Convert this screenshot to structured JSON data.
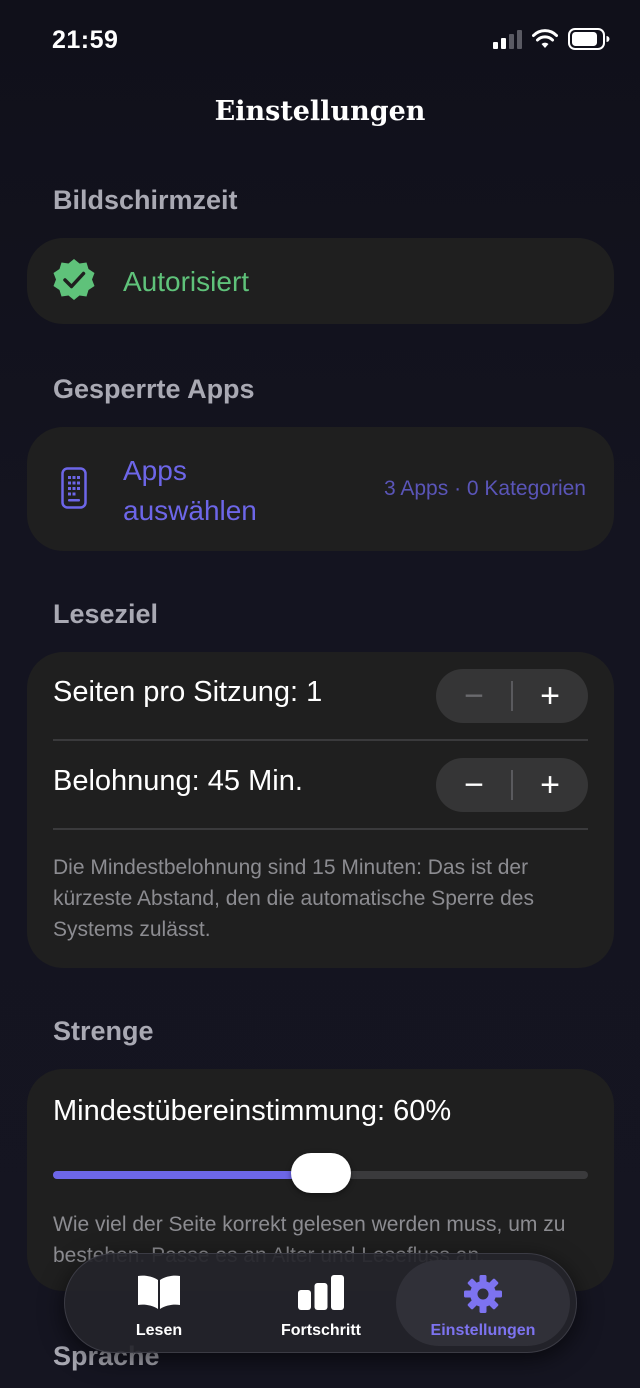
{
  "status_bar": {
    "time": "21:59",
    "icons": [
      "cellular-signal-icon",
      "wifi-icon",
      "battery-icon"
    ]
  },
  "page": {
    "title": "Einstellungen"
  },
  "screen_time": {
    "header": "Bildschirmzeit",
    "status": "Autorisiert",
    "icon": "verified-badge-icon",
    "status_color": "#5fc27a"
  },
  "blocked_apps": {
    "header": "Gesperrte Apps",
    "button_label": "Apps auswählen",
    "summary": "3 Apps · 0 Kategorien",
    "icon": "phone-apps-icon",
    "accent_color": "#6d66e8"
  },
  "reading_goal": {
    "header": "Leseziel",
    "pages_label": "Seiten pro Sitzung: 1",
    "reward_label": "Belohnung: 45 Min.",
    "minus": "−",
    "plus": "+",
    "note": "Die Mindestbelohnung sind 15 Minuten: Das ist der kürzeste Abstand, den die automatische Sperre des Systems zulässt."
  },
  "strictness": {
    "header": "Strenge",
    "match_label": "Mindestübereinstimmung: 60%",
    "slider_fraction": 0.5,
    "note": "Wie viel der Seite korrekt gelesen werden muss, um zu bestehen. Passe es an Alter und Lesefluss an."
  },
  "language": {
    "header": "Sprache"
  },
  "tab_bar": {
    "tabs": [
      {
        "label": "Lesen",
        "icon": "book-icon",
        "active": false
      },
      {
        "label": "Fortschritt",
        "icon": "bar-chart-icon",
        "active": false
      },
      {
        "label": "Einstellungen",
        "icon": "gear-icon",
        "active": true
      }
    ],
    "active_color": "#7d73f0"
  }
}
